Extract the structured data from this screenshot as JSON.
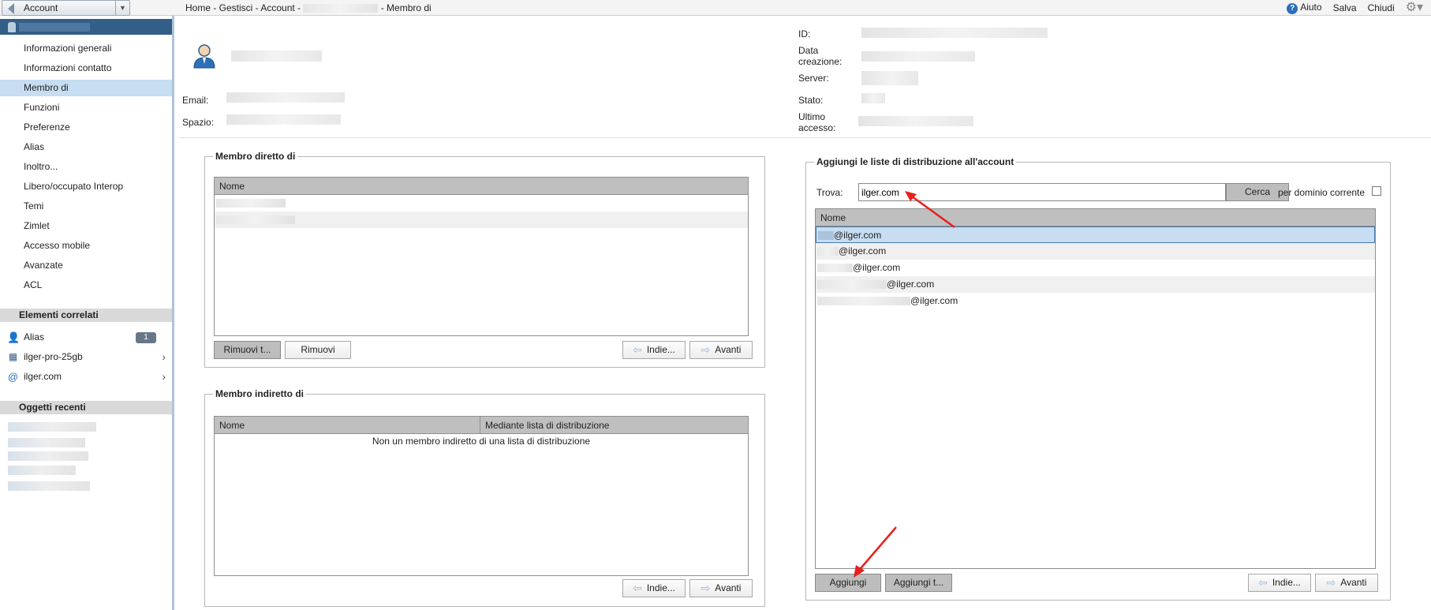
{
  "topbar": {
    "account_label": "Account",
    "breadcrumb_prefix": "Home - Gestisci - Account - ",
    "breadcrumb_suffix": " - Membro di",
    "help": "Aiuto",
    "save": "Salva",
    "close": "Chiudi"
  },
  "sidebar": {
    "items": [
      {
        "label": "Informazioni generali"
      },
      {
        "label": "Informazioni contatto"
      },
      {
        "label": "Membro di"
      },
      {
        "label": "Funzioni"
      },
      {
        "label": "Preferenze"
      },
      {
        "label": "Alias"
      },
      {
        "label": "Inoltro..."
      },
      {
        "label": "Libero/occupato Interop"
      },
      {
        "label": "Temi"
      },
      {
        "label": "Zimlet"
      },
      {
        "label": "Accesso mobile"
      },
      {
        "label": "Avanzate"
      },
      {
        "label": "ACL"
      }
    ],
    "related_title": "Elementi correlati",
    "related": [
      {
        "label": "Alias",
        "count": "1",
        "icon": "alias-icon"
      },
      {
        "label": "ilger-pro-25gb",
        "icon": "cos-icon"
      },
      {
        "label": "ilger.com",
        "icon": "at-icon"
      }
    ],
    "recent_title": "Oggetti recenti"
  },
  "header": {
    "email_label": "Email:",
    "space_label": "Spazio:",
    "id_label": "ID:",
    "created_label_1": "Data",
    "created_label_2": "creazione:",
    "server_label": "Server:",
    "status_label": "Stato:",
    "last_access_label_1": "Ultimo",
    "last_access_label_2": "accesso:"
  },
  "direct": {
    "title": "Membro diretto di",
    "col_name": "Nome",
    "btn_remove_all": "Rimuovi t...",
    "btn_remove": "Rimuovi",
    "btn_prev": "Indie...",
    "btn_next": "Avanti"
  },
  "indirect": {
    "title": "Membro indiretto di",
    "col_name": "Nome",
    "col_via": "Mediante lista di distribuzione",
    "empty": "Non un membro indiretto di una lista di distribuzione",
    "btn_prev": "Indie...",
    "btn_next": "Avanti"
  },
  "add_lists": {
    "title": "Aggiungi le liste di distribuzione all'account",
    "find_label": "Trova:",
    "find_value": "ilger.com",
    "search_btn": "Cerca",
    "domain_only_label": "per dominio corrente",
    "col_name": "Nome",
    "results": [
      "@ilger.com",
      "@ilger.com",
      "@ilger.com",
      "@ilger.com",
      "@ilger.com"
    ],
    "btn_add": "Aggiungi",
    "btn_add_all": "Aggiungi t...",
    "btn_prev": "Indie...",
    "btn_next": "Avanti"
  },
  "colors": {
    "accent": "#335e88",
    "selection": "#c6ddf2",
    "annotation_arrow": "#e8201c"
  }
}
